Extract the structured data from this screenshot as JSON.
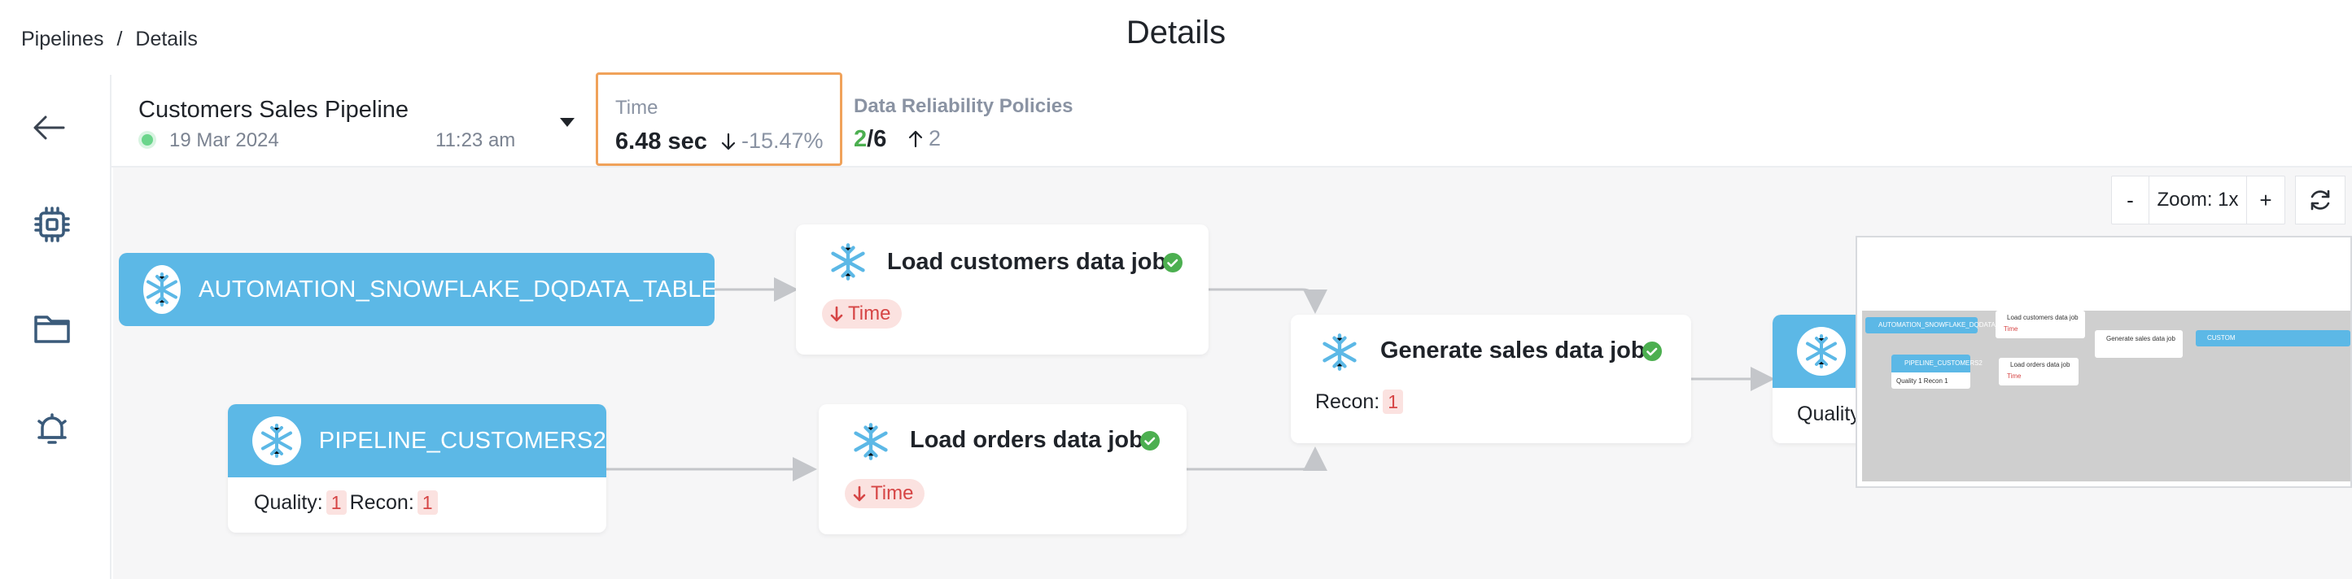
{
  "breadcrumb": {
    "root": "Pipelines",
    "separator": "/",
    "current": "Details"
  },
  "page_title": "Details",
  "pipeline": {
    "name": "Customers Sales Pipeline",
    "date": "19 Mar 2024",
    "time": "11:23 am",
    "status_color": "#6bd58b"
  },
  "metrics": {
    "time": {
      "label": "Time",
      "value": "6.48 sec",
      "delta": "-15.47%",
      "delta_direction": "down",
      "highlight_color": "#f0a25a"
    },
    "policies": {
      "label": "Data Reliability Policies",
      "passed": "2",
      "total": "/6",
      "delta": "2",
      "delta_direction": "up"
    }
  },
  "zoom": {
    "minus": "-",
    "label": "Zoom: 1x",
    "plus": "+",
    "refresh_icon": "refresh-icon"
  },
  "rail": {
    "back_icon": "arrow-left-icon",
    "items": [
      "chip-icon",
      "folder-icon",
      "alarm-icon"
    ]
  },
  "nodes": {
    "source_table": {
      "label": "AUTOMATION_SNOWFLAKE_DQDATA_TABLE"
    },
    "source_pipeline": {
      "label": "PIPELINE_CUSTOMERS2",
      "quality_label": "Quality:",
      "quality_count": "1",
      "recon_label": "Recon:",
      "recon_count": "1"
    },
    "job_customers": {
      "title": "Load customers data job",
      "badge": "Time"
    },
    "job_orders": {
      "title": "Load orders data job",
      "badge": "Time"
    },
    "job_sales": {
      "title": "Generate sales data job",
      "recon_label": "Recon:",
      "recon_count": "1"
    },
    "partial_node": {
      "quality_label": "Quality"
    }
  },
  "minimap": {
    "source_table": "AUTOMATION_SNOWFLAKE_DQDATA_TABLE",
    "source_pipeline": "PIPELINE_CUSTOMERS2",
    "pipeline_meta": "Quality 1 Recon 1",
    "job_customers": "Load customers data job",
    "job_orders": "Load orders data job",
    "job_sales": "Generate sales data job",
    "badge": "Time",
    "edge_label": "CUSTOM"
  },
  "colors": {
    "accent_blue": "#5cb8e6",
    "success": "#4caf50",
    "error": "#d64545",
    "badge_bg": "#fbe2e0"
  }
}
